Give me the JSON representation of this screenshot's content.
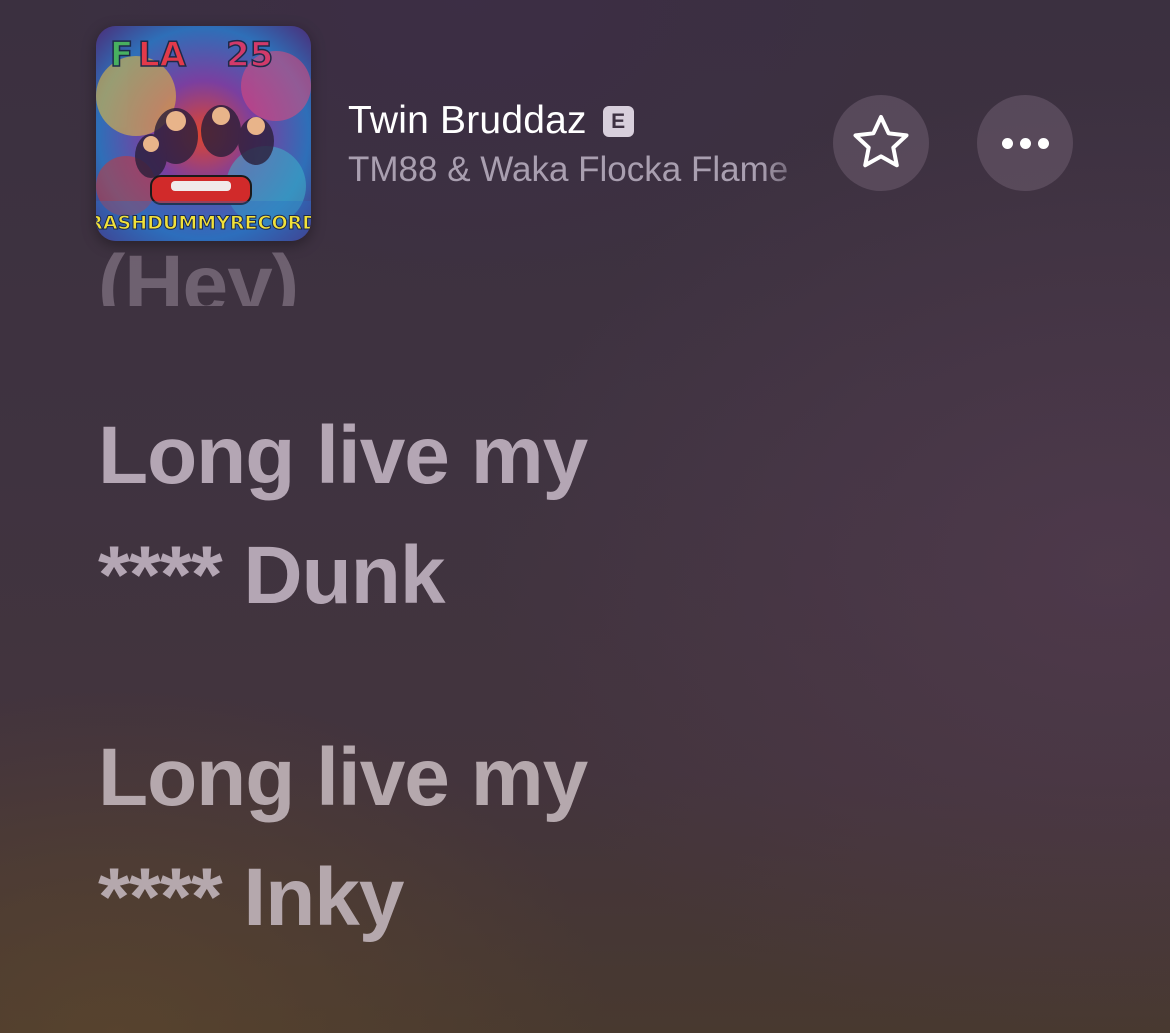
{
  "now_playing": {
    "title": "Twin Bruddaz",
    "explicit_badge": "E",
    "artist": "TM88 & Waka Flocka Flame",
    "album_art_text": "CRASHDUMMYRECORDS"
  },
  "controls": {
    "favorite_icon": "star-icon",
    "more_icon": "ellipsis-icon"
  },
  "lyrics": {
    "previous_line": "(Hey)",
    "lines": [
      [
        "Long live my",
        "**** Dunk"
      ],
      [
        "Long live my",
        "**** Inky"
      ]
    ]
  }
}
